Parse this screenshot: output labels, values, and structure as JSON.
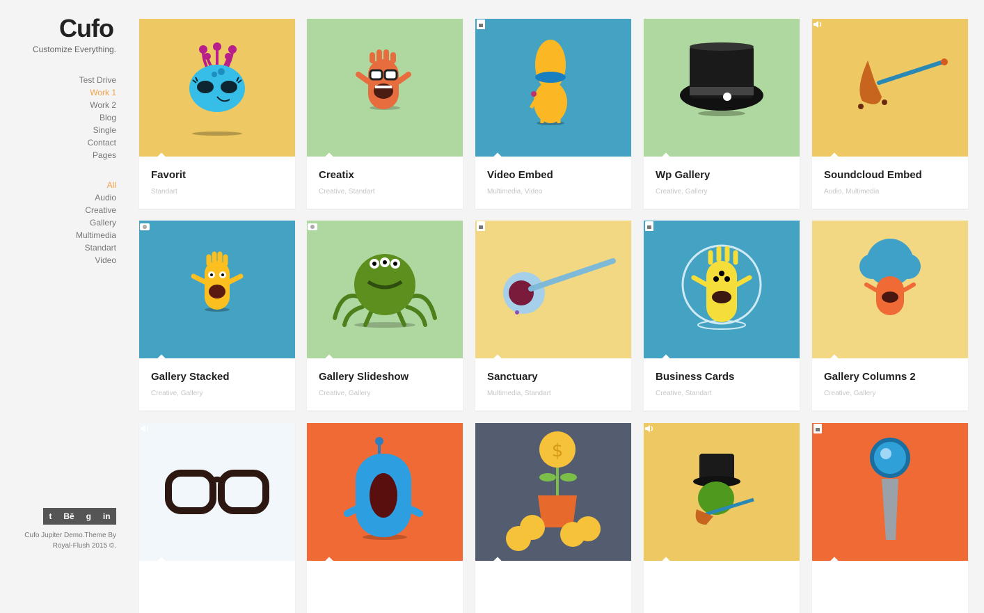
{
  "brand": {
    "logo": "Cufo",
    "tagline": "Customize Everything."
  },
  "nav": [
    "Test Drive",
    "Work 1",
    "Work 2",
    "Blog",
    "Single",
    "Contact",
    "Pages"
  ],
  "nav_active": "Work 1",
  "filters": [
    "All",
    "Audio",
    "Creative",
    "Gallery",
    "Multimedia",
    "Standart",
    "Video"
  ],
  "filters_active": "All",
  "social": {
    "twitter": "t",
    "behance": "Bē",
    "google": "g",
    "linkedin": "in"
  },
  "footer": {
    "line1": "Cufo Jupiter Demo.Theme By",
    "line2": "Royal-Flush 2015 ©."
  },
  "colors": {
    "accent": "#f0a24a",
    "yellow": "#eec963",
    "green": "#afd8a0",
    "blue": "#44a3c2",
    "lightyellow": "#f2d883",
    "orange": "#ef6a34",
    "slate": "#535d6f",
    "paleblue": "#f1f7fb"
  },
  "cards": [
    {
      "title": "Favorit",
      "categories": "Standart",
      "bg": "#eec963",
      "art": "alien-icon",
      "type": ""
    },
    {
      "title": "Creatix",
      "categories": "Creative, Standart",
      "bg": "#afd8a0",
      "art": "monster-glasses-icon",
      "type": ""
    },
    {
      "title": "Video Embed",
      "categories": "Multimedia, Video",
      "bg": "#44a3c2",
      "art": "yellow-monster-icon",
      "type": "video"
    },
    {
      "title": "Wp Gallery",
      "categories": "Creative, Gallery",
      "bg": "#afd8a0",
      "art": "top-hat-icon",
      "type": ""
    },
    {
      "title": "Soundcloud Embed",
      "categories": "Audio, Multimedia",
      "bg": "#eec963",
      "art": "guitar-icon",
      "type": "audio"
    },
    {
      "title": "Gallery Stacked",
      "categories": "Creative, Gallery",
      "bg": "#44a3c2",
      "art": "yellow-hand-monster-icon",
      "type": "gallery"
    },
    {
      "title": "Gallery Slideshow",
      "categories": "Creative, Gallery",
      "bg": "#afd8a0",
      "art": "spider-monster-icon",
      "type": "gallery"
    },
    {
      "title": "Sanctuary",
      "categories": "Multimedia, Standart",
      "bg": "#f2d883",
      "art": "banjo-icon",
      "type": "video"
    },
    {
      "title": "Business Cards",
      "categories": "Creative, Standart",
      "bg": "#44a3c2",
      "art": "astronaut-monster-icon",
      "type": "video"
    },
    {
      "title": "Gallery Columns 2",
      "categories": "Creative, Gallery",
      "bg": "#f2d883",
      "art": "afro-monster-icon",
      "type": ""
    },
    {
      "title": "",
      "categories": "",
      "bg": "#f1f7fb",
      "art": "glasses-icon",
      "type": "audio"
    },
    {
      "title": "",
      "categories": "",
      "bg": "#ef6a34",
      "art": "screaming-monster-icon",
      "type": ""
    },
    {
      "title": "",
      "categories": "",
      "bg": "#535d6f",
      "art": "money-plant-icon",
      "type": ""
    },
    {
      "title": "",
      "categories": "",
      "bg": "#eec963",
      "art": "hat-guitar-monster-icon",
      "type": "audio"
    },
    {
      "title": "",
      "categories": "",
      "bg": "#ef6a34",
      "art": "microphone-icon",
      "type": "video"
    }
  ]
}
